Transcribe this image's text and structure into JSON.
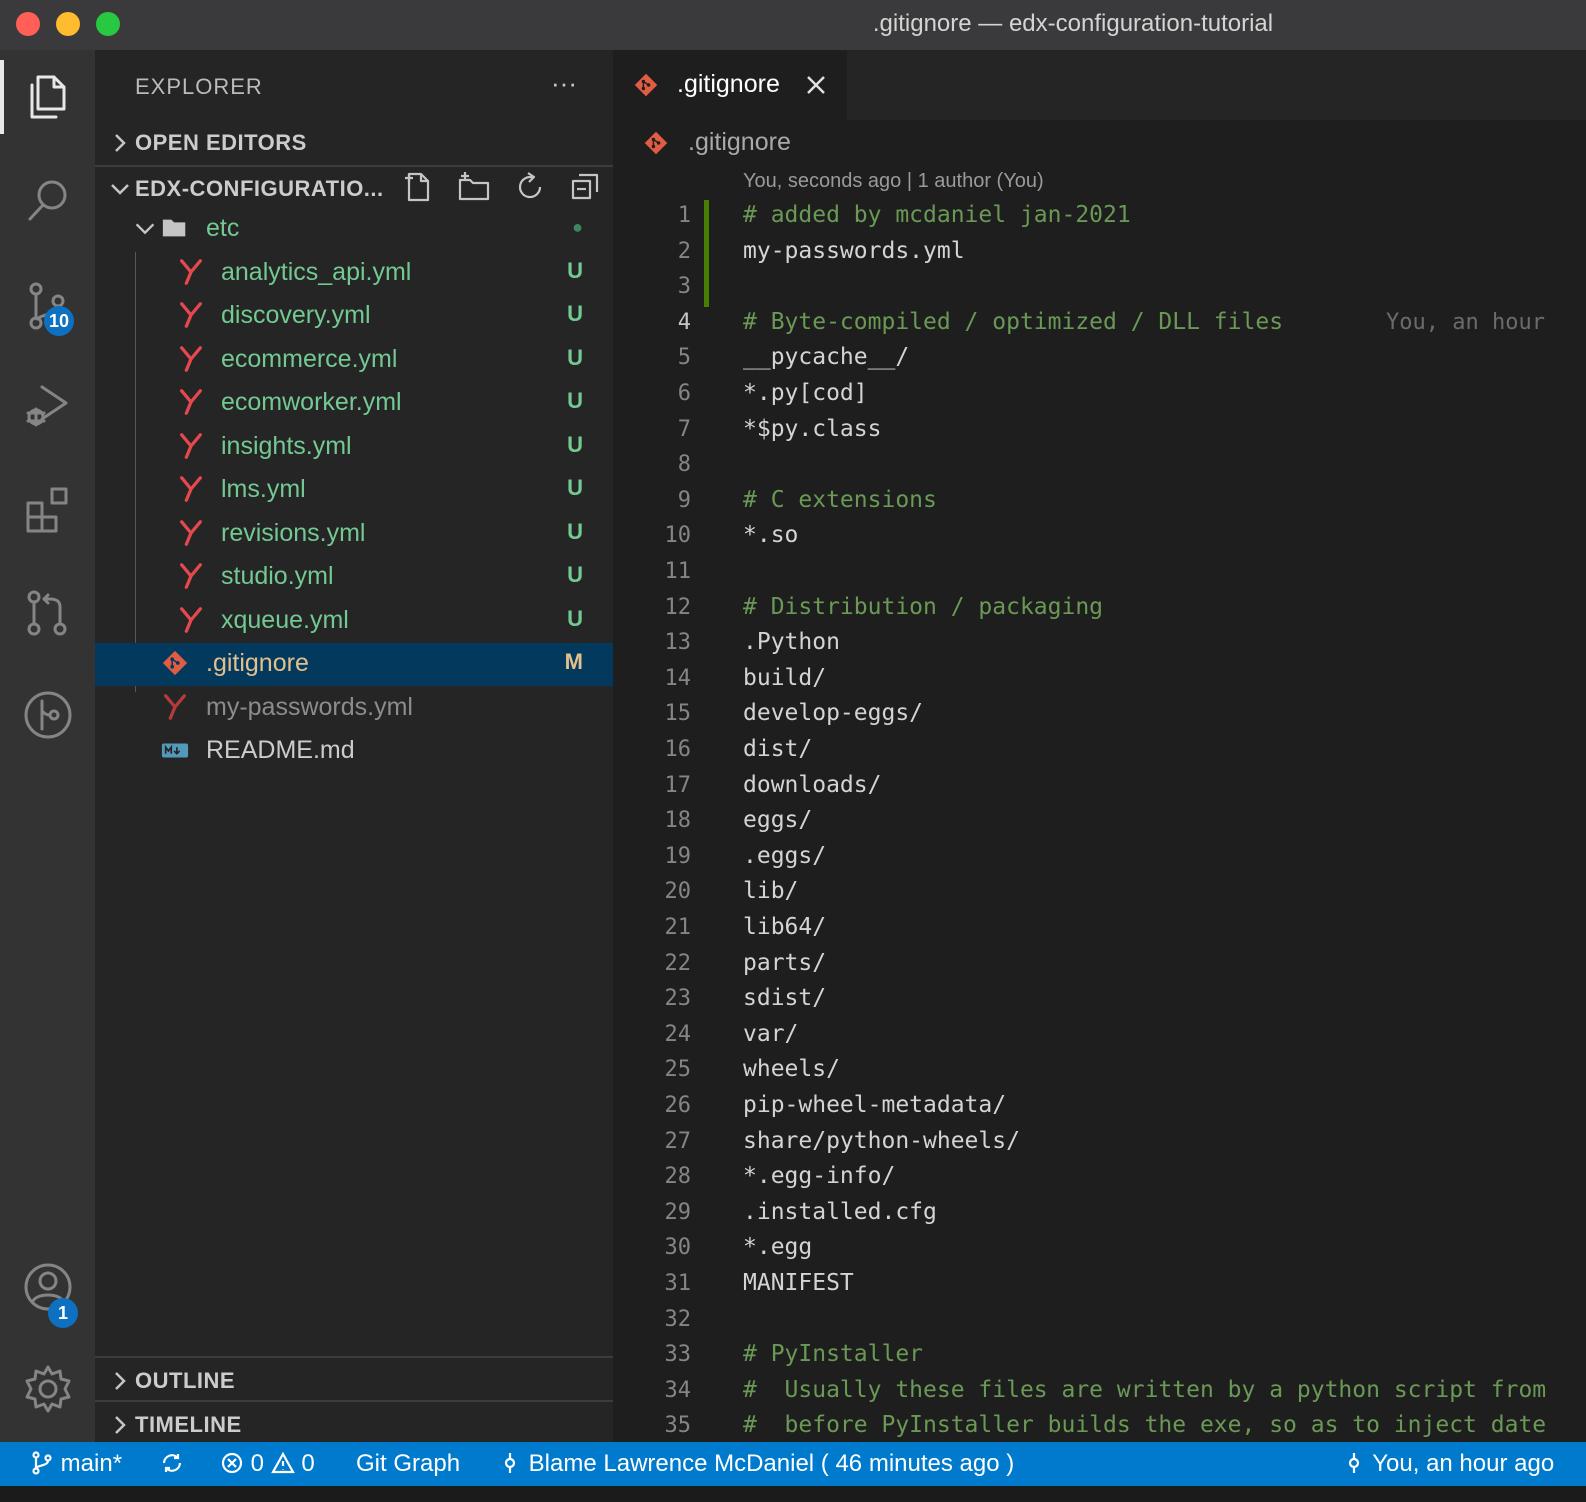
{
  "window": {
    "title": ".gitignore — edx-configuration-tutorial"
  },
  "activity_bar": {
    "items": [
      "explorer",
      "search",
      "source-control",
      "run-debug",
      "extensions",
      "pull-requests",
      "git-graph"
    ],
    "source_control_badge": "10",
    "accounts_badge": "1"
  },
  "sidebar": {
    "title": "EXPLORER",
    "more": "···",
    "open_editors": "OPEN EDITORS",
    "project": "EDX-CONFIGURATIO...",
    "outline": "OUTLINE",
    "timeline": "TIMELINE",
    "tree": [
      {
        "name": "etc",
        "type": "folder",
        "status": "●"
      },
      {
        "name": "analytics_api.yml",
        "type": "yaml",
        "status": "U"
      },
      {
        "name": "discovery.yml",
        "type": "yaml",
        "status": "U"
      },
      {
        "name": "ecommerce.yml",
        "type": "yaml",
        "status": "U"
      },
      {
        "name": "ecomworker.yml",
        "type": "yaml",
        "status": "U"
      },
      {
        "name": "insights.yml",
        "type": "yaml",
        "status": "U"
      },
      {
        "name": "lms.yml",
        "type": "yaml",
        "status": "U"
      },
      {
        "name": "revisions.yml",
        "type": "yaml",
        "status": "U"
      },
      {
        "name": "studio.yml",
        "type": "yaml",
        "status": "U"
      },
      {
        "name": "xqueue.yml",
        "type": "yaml",
        "status": "U"
      },
      {
        "name": ".gitignore",
        "type": "git",
        "status": "M"
      },
      {
        "name": "my-passwords.yml",
        "type": "yaml",
        "status": ""
      },
      {
        "name": "README.md",
        "type": "markdown",
        "status": ""
      }
    ]
  },
  "editor": {
    "tab_label": ".gitignore",
    "breadcrumb": ".gitignore",
    "codelens": "You, seconds ago | 1 author (You)",
    "blame_line_4": "You, an hour",
    "lines": [
      "# added by mcdaniel jan-2021",
      "my-passwords.yml",
      "",
      "# Byte-compiled / optimized / DLL files",
      "__pycache__/",
      "*.py[cod]",
      "*$py.class",
      "",
      "# C extensions",
      "*.so",
      "",
      "# Distribution / packaging",
      ".Python",
      "build/",
      "develop-eggs/",
      "dist/",
      "downloads/",
      "eggs/",
      ".eggs/",
      "lib/",
      "lib64/",
      "parts/",
      "sdist/",
      "var/",
      "wheels/",
      "pip-wheel-metadata/",
      "share/python-wheels/",
      "*.egg-info/",
      ".installed.cfg",
      "*.egg",
      "MANIFEST",
      "",
      "# PyInstaller",
      "#  Usually these files are written by a python script from",
      "#  before PyInstaller builds the exe, so as to inject date"
    ]
  },
  "status_bar": {
    "branch": "main*",
    "errors": "0",
    "warnings": "0",
    "git_graph": "Git Graph",
    "blame": "Blame Lawrence McDaniel ( 46 minutes ago )",
    "right": "You, an hour ago"
  },
  "colors": {
    "accent": "#007acc",
    "untracked": "#73c991",
    "yaml_icon": "#e5484d",
    "git_icon": "#e05d44",
    "comment": "#6a9955",
    "gutter_added": "#487e02"
  }
}
